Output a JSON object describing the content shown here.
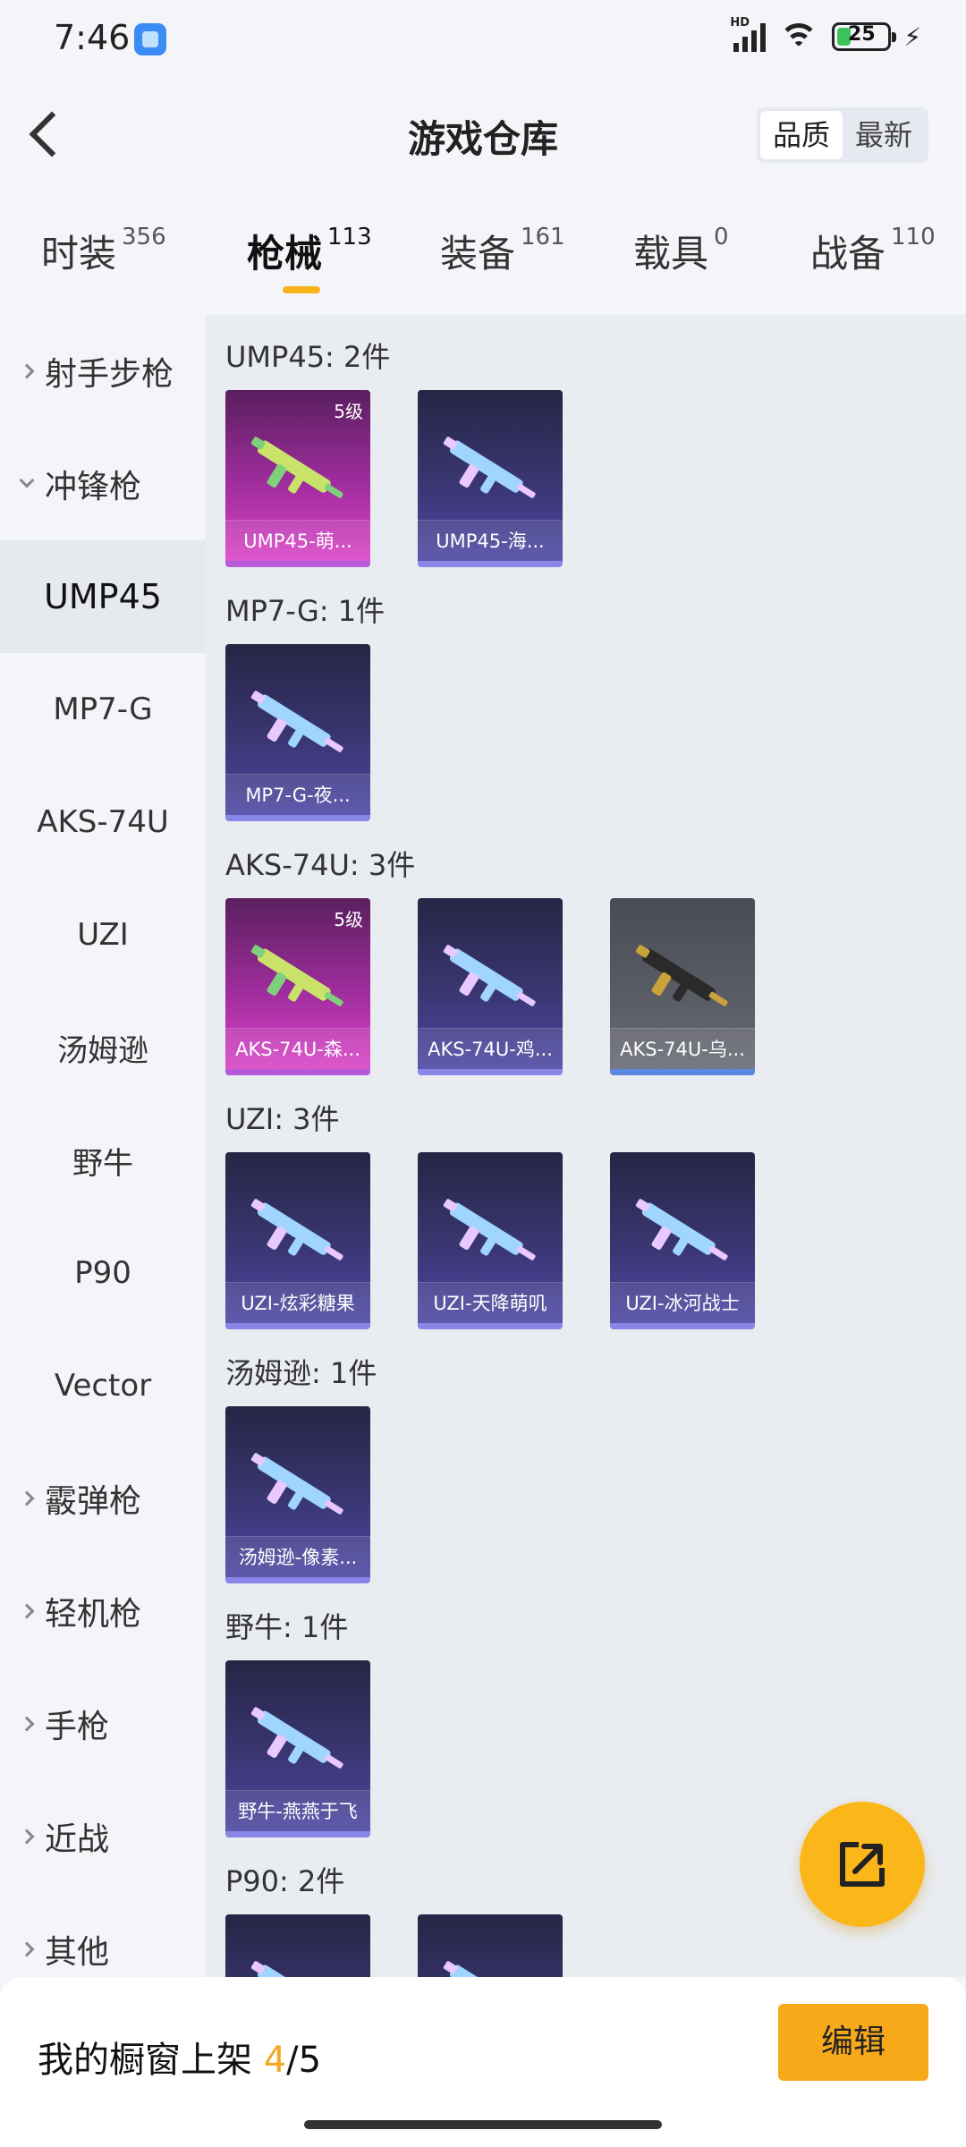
{
  "status_bar": {
    "time": "7:46",
    "battery": "25",
    "hd": "HD"
  },
  "header": {
    "title": "游戏仓库",
    "sort_options": [
      "品质",
      "最新"
    ],
    "sort_active": "品质"
  },
  "category_tabs": [
    {
      "label": "时装",
      "count": "356"
    },
    {
      "label": "枪械",
      "count": "113"
    },
    {
      "label": "装备",
      "count": "161"
    },
    {
      "label": "载具",
      "count": "0"
    },
    {
      "label": "战备",
      "count": "110"
    }
  ],
  "sidebar": {
    "items": [
      "射手步枪",
      "冲锋枪",
      "UMP45",
      "MP7-G",
      "AKS-74U",
      "UZI",
      "汤姆逊",
      "野牛",
      "P90",
      "Vector",
      "霰弹枪",
      "轻机枪",
      "手枪",
      "近战",
      "其他"
    ]
  },
  "sections": [
    {
      "title": "UMP45: 2件",
      "items": [
        {
          "name": "UMP45-萌...",
          "level": "5级",
          "quality": "pink"
        },
        {
          "name": "UMP45-海...",
          "level": "",
          "quality": "purple"
        }
      ]
    },
    {
      "title": "MP7-G: 1件",
      "items": [
        {
          "name": "MP7-G-夜...",
          "level": "",
          "quality": "purple"
        }
      ]
    },
    {
      "title": "AKS-74U: 3件",
      "items": [
        {
          "name": "AKS-74U-森...",
          "level": "5级",
          "quality": "pink"
        },
        {
          "name": "AKS-74U-鸡...",
          "level": "",
          "quality": "purple"
        },
        {
          "name": "AKS-74U-乌...",
          "level": "",
          "quality": "grey"
        }
      ]
    },
    {
      "title": "UZI: 3件",
      "items": [
        {
          "name": "UZI-炫彩糖果",
          "level": "",
          "quality": "purple"
        },
        {
          "name": "UZI-天降萌叽",
          "level": "",
          "quality": "purple"
        },
        {
          "name": "UZI-冰河战士",
          "level": "",
          "quality": "purple"
        }
      ]
    },
    {
      "title": "汤姆逊: 1件",
      "items": [
        {
          "name": "汤姆逊-像素...",
          "level": "",
          "quality": "purple"
        }
      ]
    },
    {
      "title": "野牛: 1件",
      "items": [
        {
          "name": "野牛-燕燕于飞",
          "level": "",
          "quality": "purple"
        }
      ]
    },
    {
      "title": "P90: 2件",
      "items": [
        {
          "name": "",
          "level": "",
          "quality": "purple"
        },
        {
          "name": "",
          "level": "",
          "quality": "purple"
        }
      ]
    }
  ],
  "bottom_bar": {
    "label": "我的橱窗上架",
    "current": "4",
    "sep_total": "/5",
    "edit_label": "编辑"
  },
  "colors": {
    "accent": "#f7a91a",
    "pink_quality": "#d944c6",
    "purple_quality": "#4d47a3",
    "grey_quality": "#5a5c66"
  },
  "icons": {
    "fab": "share-external-icon",
    "back": "back-arrow-icon"
  }
}
